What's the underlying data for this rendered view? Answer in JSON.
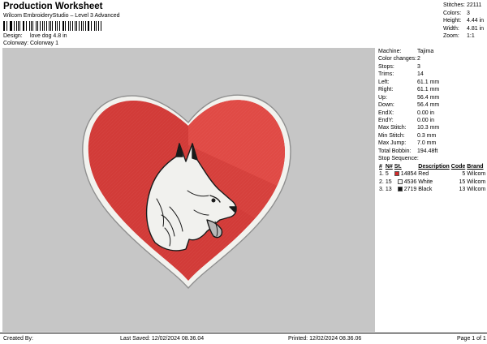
{
  "header": {
    "title": "Production Worksheet",
    "subtitle": "Wilcom EmbroideryStudio – Level 3 Advanced",
    "design_label": "Design:",
    "design_value": "love dog 4.8 in",
    "colorway_label": "Colorway:",
    "colorway_value": "Colorway 1"
  },
  "summary": {
    "stitches_label": "Stitches:",
    "stitches_value": "22111",
    "colors_label": "Colors:",
    "colors_value": "3",
    "height_label": "Height:",
    "height_value": "4.44 in",
    "width_label": "Width:",
    "width_value": "4.81 in",
    "zoom_label": "Zoom:",
    "zoom_value": "1:1"
  },
  "details": [
    {
      "label": "Machine:",
      "value": "Tajima"
    },
    {
      "label": "Color changes:",
      "value": "2"
    },
    {
      "label": "Stops:",
      "value": "3"
    },
    {
      "label": "Trims:",
      "value": "14"
    },
    {
      "label": "Left:",
      "value": "61.1 mm"
    },
    {
      "label": "Right:",
      "value": "61.1 mm"
    },
    {
      "label": "Up:",
      "value": "56.4 mm"
    },
    {
      "label": "Down:",
      "value": "56.4 mm"
    },
    {
      "label": "EndX:",
      "value": "0.00 in"
    },
    {
      "label": "EndY:",
      "value": "0.00 in"
    },
    {
      "label": "Max Stitch:",
      "value": "10.3 mm"
    },
    {
      "label": "Min Stitch:",
      "value": "0.3 mm"
    },
    {
      "label": "Max Jump:",
      "value": "7.0 mm"
    },
    {
      "label": "Total Bobbin:",
      "value": "194.48ft"
    }
  ],
  "stop_sequence": {
    "title": "Stop Sequence:",
    "headers": [
      "#",
      "N#",
      "St.",
      "Description",
      "Code",
      "Brand"
    ],
    "rows": [
      {
        "idx": "1.",
        "n": "5",
        "color": "#d42a2a",
        "st": "14854",
        "desc": "Red",
        "code": "5",
        "brand": "Wilcom"
      },
      {
        "idx": "2.",
        "n": "15",
        "color": "#f4f4f2",
        "st": "4536",
        "desc": "White",
        "code": "15",
        "brand": "Wilcom"
      },
      {
        "idx": "3.",
        "n": "13",
        "color": "#111111",
        "st": "2719",
        "desc": "Black",
        "code": "13",
        "brand": "Wilcom"
      }
    ]
  },
  "footer": {
    "created_by": "Created By:",
    "last_saved": "Last Saved: 12/02/2024 08.36.04",
    "printed": "Printed: 12/02/2024 08.36.06",
    "page": "Page 1 of 1"
  },
  "colors": {
    "preview_background": "#c6c6c6",
    "heart_red": "#d23b38",
    "heart_border": "#f2f2ee"
  }
}
